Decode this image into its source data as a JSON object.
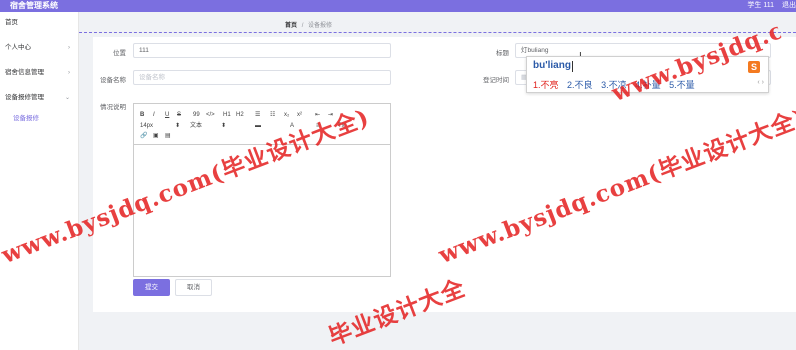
{
  "app": {
    "title": "宿舍管理系统",
    "user": "学生 111",
    "logout": "退出"
  },
  "sidebar": {
    "items": [
      {
        "label": "首页",
        "chevron": ""
      },
      {
        "label": "个人中心",
        "chevron": "›"
      },
      {
        "label": "宿舍信息管理",
        "chevron": "›"
      },
      {
        "label": "设备报修管理",
        "chevron": "⌄"
      },
      {
        "label": "设备报修",
        "chevron": ""
      }
    ]
  },
  "breadcrumb": {
    "home": "首页",
    "sep": "/",
    "current": "设备报修"
  },
  "form": {
    "location": {
      "label": "位置",
      "value": "111"
    },
    "device": {
      "label": "设备名称",
      "placeholder": "设备名称"
    },
    "title": {
      "label": "标题",
      "value": "灯buliang"
    },
    "time": {
      "label": "登记时间"
    },
    "desc": {
      "label": "情况说明"
    }
  },
  "editor": {
    "row1": [
      "B",
      "I",
      "U",
      "S",
      "99",
      "</>",
      "H1",
      "H2",
      "☰",
      "☷",
      "x₂",
      "x²",
      "⇤",
      "⇥"
    ],
    "row2": [
      "14px",
      "⬍",
      "文本",
      "⬍",
      "▬",
      "A",
      "≡",
      "Tx"
    ],
    "row3": [
      "🔗",
      "▣",
      "▤"
    ]
  },
  "buttons": {
    "submit": "提交",
    "cancel": "取消"
  },
  "ime": {
    "pinyin": "bu'liang",
    "candidates": [
      "1.不亮",
      "2.不良",
      "3.不凉",
      "4.补量",
      "5.不量"
    ],
    "logo": "S",
    "arrows": "‹ ›"
  },
  "watermark": [
    "www.bysjdq.com(毕业设计大全)",
    "www.bysjdq.com(毕业设计大全)",
    "www.bysjdq.com(毕业设计大全)",
    "毕业设计大全"
  ],
  "colors": {
    "accent": "#7b6fe0",
    "watermark": "#e41e1e"
  }
}
